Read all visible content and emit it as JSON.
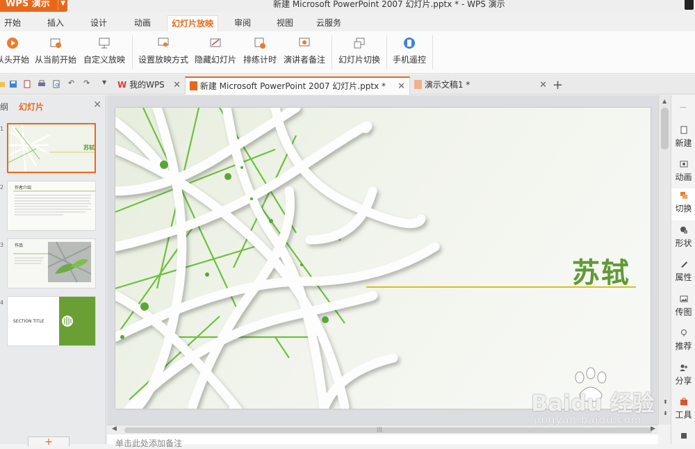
{
  "app": {
    "button_label": "WPS 演示",
    "window_title": "新建 Microsoft PowerPoint 2007 幻灯片.pptx * - WPS 演示"
  },
  "menu": {
    "tabs": [
      {
        "label": "开始"
      },
      {
        "label": "插入"
      },
      {
        "label": "设计"
      },
      {
        "label": "动画"
      },
      {
        "label": "幻灯片放映",
        "active": true
      },
      {
        "label": "审阅"
      },
      {
        "label": "视图"
      },
      {
        "label": "云服务"
      }
    ]
  },
  "ribbon": {
    "buttons": [
      {
        "label": "从头开始",
        "icon": "play-circle-icon"
      },
      {
        "label": "从当前开始",
        "icon": "play-from-current-icon"
      },
      {
        "label": "自定义放映",
        "icon": "custom-show-icon"
      },
      {
        "label": "设置放映方式",
        "icon": "setup-show-icon"
      },
      {
        "label": "隐藏幻灯片",
        "icon": "hide-slide-icon"
      },
      {
        "label": "排练计时",
        "icon": "rehearse-timing-icon"
      },
      {
        "label": "演讲者备注",
        "icon": "speaker-notes-icon"
      },
      {
        "label": "幻灯片切换",
        "icon": "slide-transition-icon"
      },
      {
        "label": "手机遥控",
        "icon": "phone-remote-icon"
      }
    ]
  },
  "doc_tabs": [
    {
      "label": "我的WPS",
      "icon": "wps-logo-icon"
    },
    {
      "label": "新建 Microsoft PowerPoint 2007 幻灯片.pptx *",
      "icon": "ppt-file-icon",
      "active": true
    },
    {
      "label": "演示文稿1 *",
      "icon": "ppt-file-icon"
    }
  ],
  "left_pane": {
    "tab_outline": "大纲",
    "tab_slides": "幻灯片",
    "slides": [
      {
        "num": "1",
        "title": "苏轼"
      },
      {
        "num": "2",
        "title": "作者介绍"
      },
      {
        "num": "3",
        "title": "作品"
      },
      {
        "num": "4",
        "title": "SECTION TITLE"
      }
    ]
  },
  "slide": {
    "title": "苏轼",
    "accent_color": "#5f9a36",
    "line_color": "#d4c21d"
  },
  "notes": {
    "placeholder": "单击此处添加备注"
  },
  "right_bar": {
    "items": [
      {
        "label": "新建",
        "icon": "new-icon"
      },
      {
        "label": "动画",
        "icon": "animation-icon"
      },
      {
        "label": "切换",
        "icon": "transition-icon",
        "active": true
      },
      {
        "label": "形状",
        "icon": "shapes-icon"
      },
      {
        "label": "属性",
        "icon": "properties-icon"
      },
      {
        "label": "传图",
        "icon": "upload-image-icon"
      },
      {
        "label": "推荐",
        "icon": "recommend-icon"
      },
      {
        "label": "分享",
        "icon": "share-icon"
      },
      {
        "label": "工具",
        "icon": "tools-icon"
      }
    ]
  },
  "watermark": {
    "brand": "Baidu 经验",
    "url": "jingyan.baidu.com"
  },
  "colors": {
    "accent": "#e8681b",
    "slide_green": "#5f9a36"
  }
}
